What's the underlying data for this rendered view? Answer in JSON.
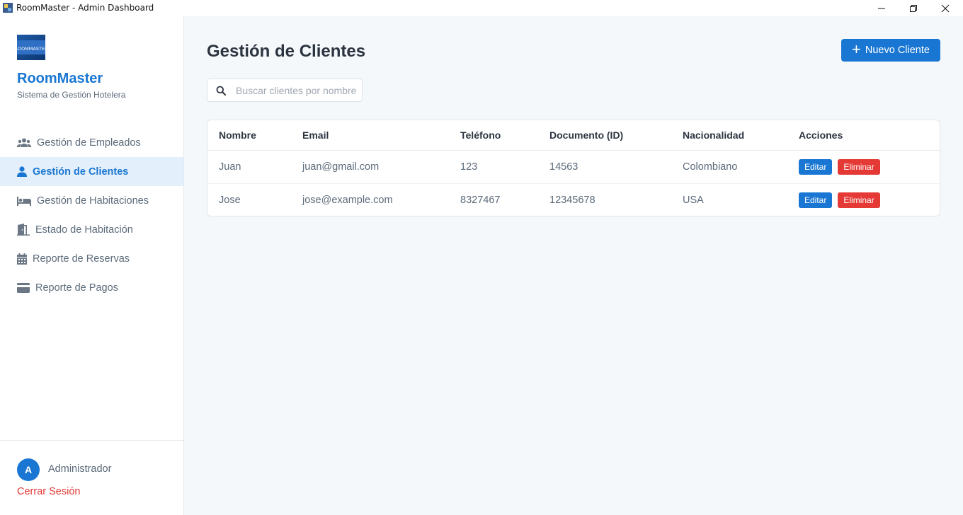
{
  "window": {
    "title": "RoomMaster - Admin Dashboard"
  },
  "sidebar": {
    "logo_text": "ROOMMASTER",
    "brand": "RoomMaster",
    "subtitle": "Sistema de Gestión Hotelera",
    "items": [
      {
        "label": "Gestión de Empleados",
        "icon": "users-icon",
        "active": false
      },
      {
        "label": "Gestión de Clientes",
        "icon": "user-icon",
        "active": true
      },
      {
        "label": "Gestión de Habitaciones",
        "icon": "bed-icon",
        "active": false
      },
      {
        "label": "Estado de Habitación",
        "icon": "door-icon",
        "active": false
      },
      {
        "label": "Reporte de Reservas",
        "icon": "calendar-icon",
        "active": false
      },
      {
        "label": "Reporte de Pagos",
        "icon": "credit-card-icon",
        "active": false
      }
    ],
    "user": {
      "avatar_letter": "A",
      "name": "Administrador",
      "logout": "Cerrar Sesión"
    }
  },
  "main": {
    "title": "Gestión de Clientes",
    "new_button": "Nuevo Cliente",
    "search": {
      "placeholder": "Buscar clientes por nombre...",
      "value": ""
    },
    "table": {
      "headers": [
        "Nombre",
        "Email",
        "Teléfono",
        "Documento (ID)",
        "Nacionalidad",
        "Acciones"
      ],
      "rows": [
        [
          "Juan",
          "juan@gmail.com",
          "123",
          "14563",
          "Colombiano"
        ],
        [
          "Jose",
          "jose@example.com",
          "8327467",
          "12345678",
          "USA"
        ]
      ],
      "edit_label": "Editar",
      "delete_label": "Eliminar"
    }
  },
  "colors": {
    "primary": "#1976d2",
    "danger": "#e53935",
    "active_bg": "#e3effb",
    "main_bg": "#f5f8fb"
  }
}
